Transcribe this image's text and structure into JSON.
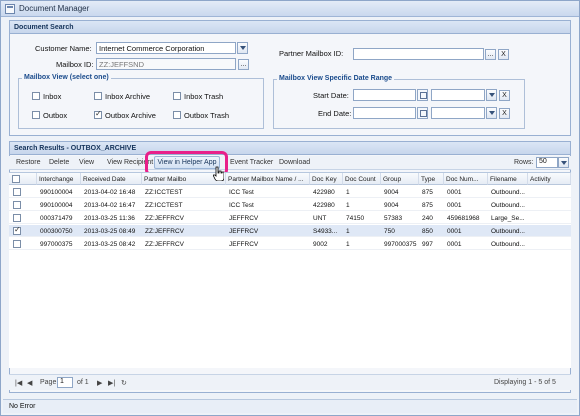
{
  "window": {
    "title": "Document Manager"
  },
  "search_panel": {
    "title": "Document Search",
    "customer_name_label": "Customer Name:",
    "customer_name_value": "Internet Commerce Corporation",
    "mailbox_id_label": "Mailbox ID:",
    "mailbox_id_value": "ZZ:JEFFSND",
    "ellipsis": "...",
    "partner_mailbox_label": "Partner Mailbox ID:",
    "partner_mailbox_value": "",
    "clear": "X",
    "mailbox_view": {
      "legend": "Mailbox View (select one)",
      "options": [
        {
          "label": "Inbox",
          "checked": false
        },
        {
          "label": "Inbox Archive",
          "checked": false
        },
        {
          "label": "Inbox Trash",
          "checked": false
        },
        {
          "label": "Outbox",
          "checked": false
        },
        {
          "label": "Outbox Archive",
          "checked": true
        },
        {
          "label": "Outbox Trash",
          "checked": false
        }
      ]
    },
    "date_range": {
      "legend": "Mailbox View Specific Date Range",
      "start_label": "Start Date:",
      "end_label": "End Date:"
    }
  },
  "results": {
    "title": "Search Results - OUTBOX_ARCHIVE",
    "toolbar": {
      "restore": "Restore",
      "delete": "Delete",
      "view": "View",
      "view_recipient": "View Recipient",
      "view_helper": "View in Helper App",
      "event_tracker": "Event Tracker",
      "download": "Download"
    },
    "rows_label": "Rows:",
    "rows_value": "50",
    "columns": [
      "Interchange",
      "Received Date",
      "Partner Mailbo",
      "Partner Mailbox Name / ...",
      "Doc Key",
      "Doc Count",
      "Group",
      "Type",
      "Doc Num...",
      "Filename",
      "Activity"
    ],
    "rows": [
      {
        "checked": false,
        "selected": false,
        "cells": [
          "990100004",
          "2013-04-02 16:48",
          "ZZ:ICCTEST",
          "ICC Test",
          "422980",
          "1",
          "9004",
          "875",
          "0001",
          "Outbound...",
          ""
        ]
      },
      {
        "checked": false,
        "selected": false,
        "cells": [
          "990100004",
          "2013-04-02 16:47",
          "ZZ:ICCTEST",
          "ICC Test",
          "422980",
          "1",
          "9004",
          "875",
          "0001",
          "Outbound...",
          ""
        ]
      },
      {
        "checked": false,
        "selected": false,
        "cells": [
          "000371479",
          "2013-03-25 11:36",
          "ZZ:JEFFRCV",
          "JEFFRCV",
          "UNT",
          "74150",
          "57383",
          "240",
          "459681968",
          "Large_Se...",
          ""
        ]
      },
      {
        "checked": true,
        "selected": true,
        "cells": [
          "000300750",
          "2013-03-25 08:49",
          "ZZ:JEFFRCV",
          "JEFFRCV",
          "S4933...",
          "1",
          "750",
          "850",
          "0001",
          "Outbound...",
          ""
        ]
      },
      {
        "checked": false,
        "selected": false,
        "cells": [
          "997000375",
          "2013-03-25 08:42",
          "ZZ:JEFFRCV",
          "JEFFRCV",
          "9002",
          "1",
          "997000375",
          "997",
          "0001",
          "Outbound...",
          ""
        ]
      }
    ],
    "pager": {
      "page_label": "Page",
      "page_value": "1",
      "of_label": "of 1",
      "displaying": "Displaying 1 - 5 of 5"
    }
  },
  "status": {
    "text": "No Error"
  },
  "colors": {
    "highlight": "#e8208a",
    "header_text": "#15335a",
    "legend_text": "#1a4b8c"
  }
}
